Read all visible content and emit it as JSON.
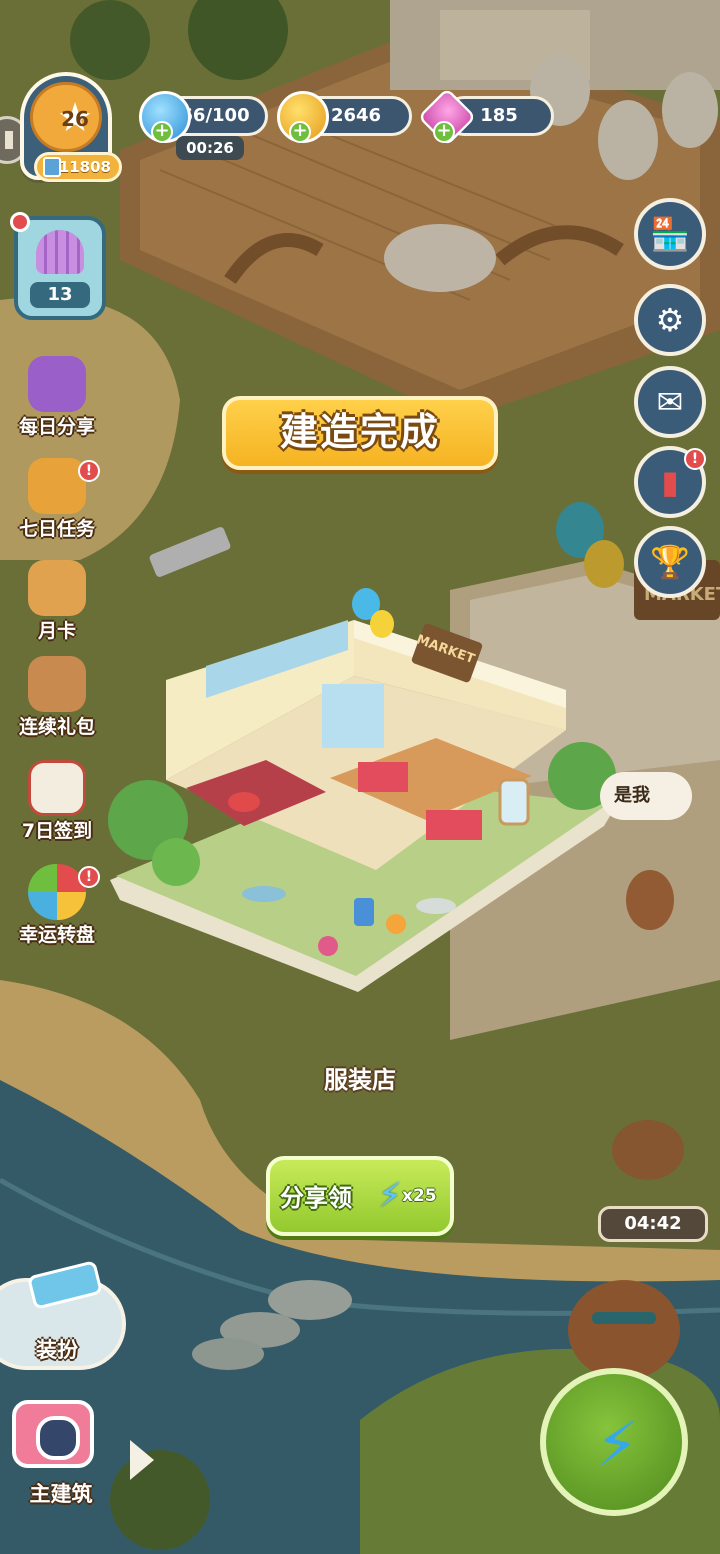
{
  "hud": {
    "level": "26",
    "xp": "11808",
    "energy": "66/100",
    "energy_timer": "00:26",
    "coins": "2646",
    "gems": "185"
  },
  "left_menu": {
    "shell_count": "13",
    "items": [
      {
        "label": "每日分享",
        "badge": false
      },
      {
        "label": "七日任务",
        "badge": true
      },
      {
        "label": "月卡",
        "badge": false
      },
      {
        "label": "连续礼包",
        "badge": false
      },
      {
        "label": "7日签到",
        "badge": false
      },
      {
        "label": "幸运转盘",
        "badge": true
      }
    ]
  },
  "right_menu": {
    "shop_icon": "shop-icon",
    "settings_icon": "gear-icon",
    "mail_icon": "mail-icon",
    "book_icon": "book-icon",
    "trophy_icon": "trophy-icon"
  },
  "popup": {
    "title": "建造完成",
    "building_name": "服装店",
    "share_label": "分享领",
    "reward": "x25",
    "sign_text": "MARKET"
  },
  "scene": {
    "speech_bubble": "是我",
    "sign_text": "MARKET",
    "event_timer": "04:42"
  },
  "bottom": {
    "dress_label": "装扮",
    "build_label": "主建筑"
  },
  "colors": {
    "banner": "#f5b322",
    "share_button": "#93c92e",
    "hud_panel": "#3d5670",
    "badge_red": "#e24c4c"
  }
}
